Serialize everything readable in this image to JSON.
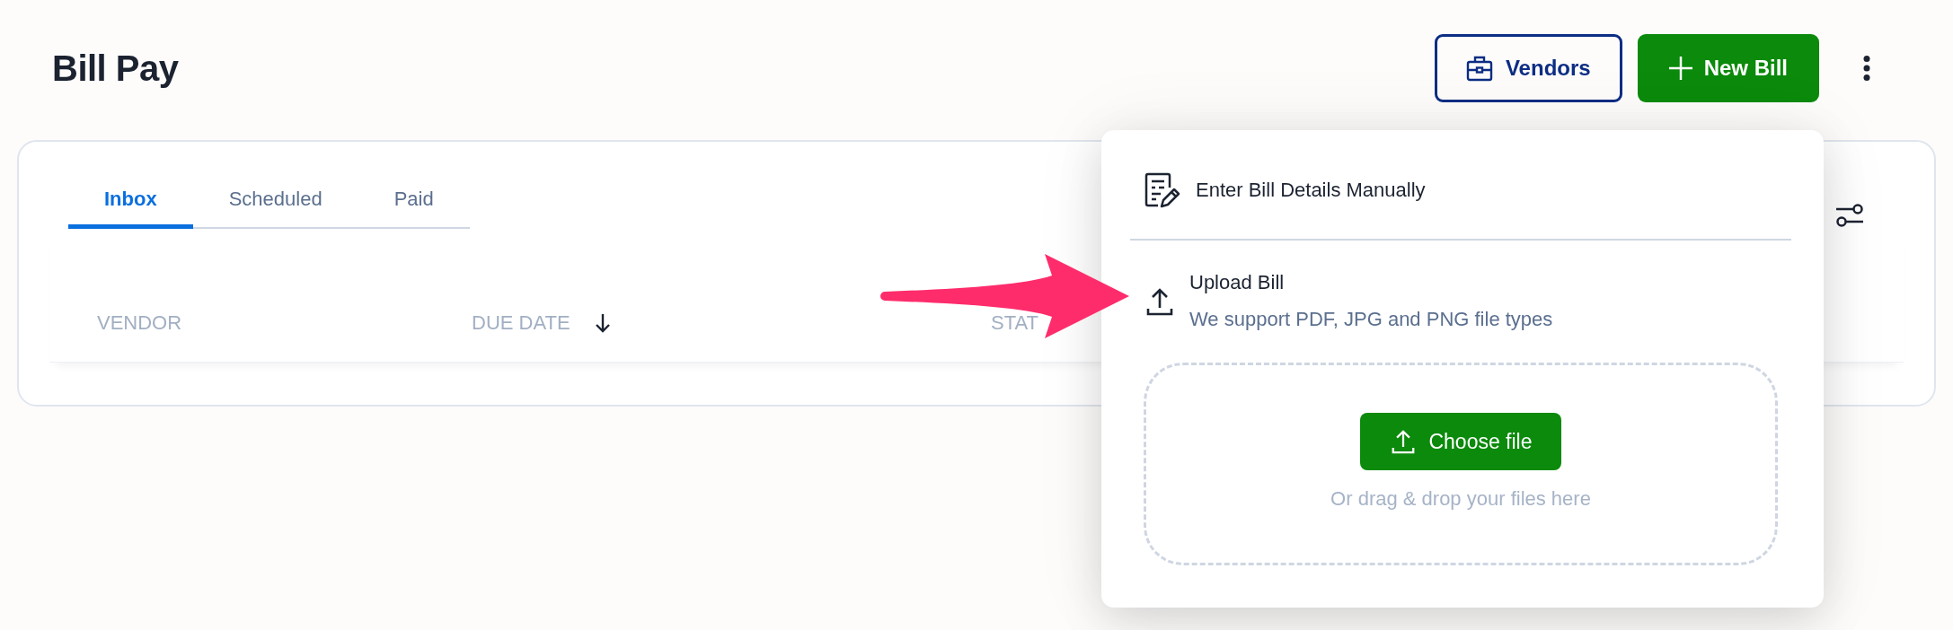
{
  "page": {
    "title": "Bill Pay"
  },
  "header_actions": {
    "vendors_button": "Vendors",
    "new_bill_button": "New Bill"
  },
  "tabs": [
    {
      "label": "Inbox",
      "selected": true
    },
    {
      "label": "Scheduled",
      "selected": false
    },
    {
      "label": "Paid",
      "selected": false
    }
  ],
  "table": {
    "columns": [
      {
        "label": "VENDOR",
        "sorted": false
      },
      {
        "label": "DUE DATE",
        "sorted": true
      },
      {
        "label": "STAT",
        "sorted": false
      }
    ]
  },
  "new_bill_menu": {
    "items": [
      {
        "kind": "manual",
        "label": "Enter Bill Details Manually"
      },
      {
        "kind": "upload",
        "label": "Upload Bill",
        "description": "We support PDF, JPG and PNG file types"
      }
    ],
    "dropzone": {
      "button": "Choose file",
      "hint": "Or drag & drop your files here"
    }
  }
}
